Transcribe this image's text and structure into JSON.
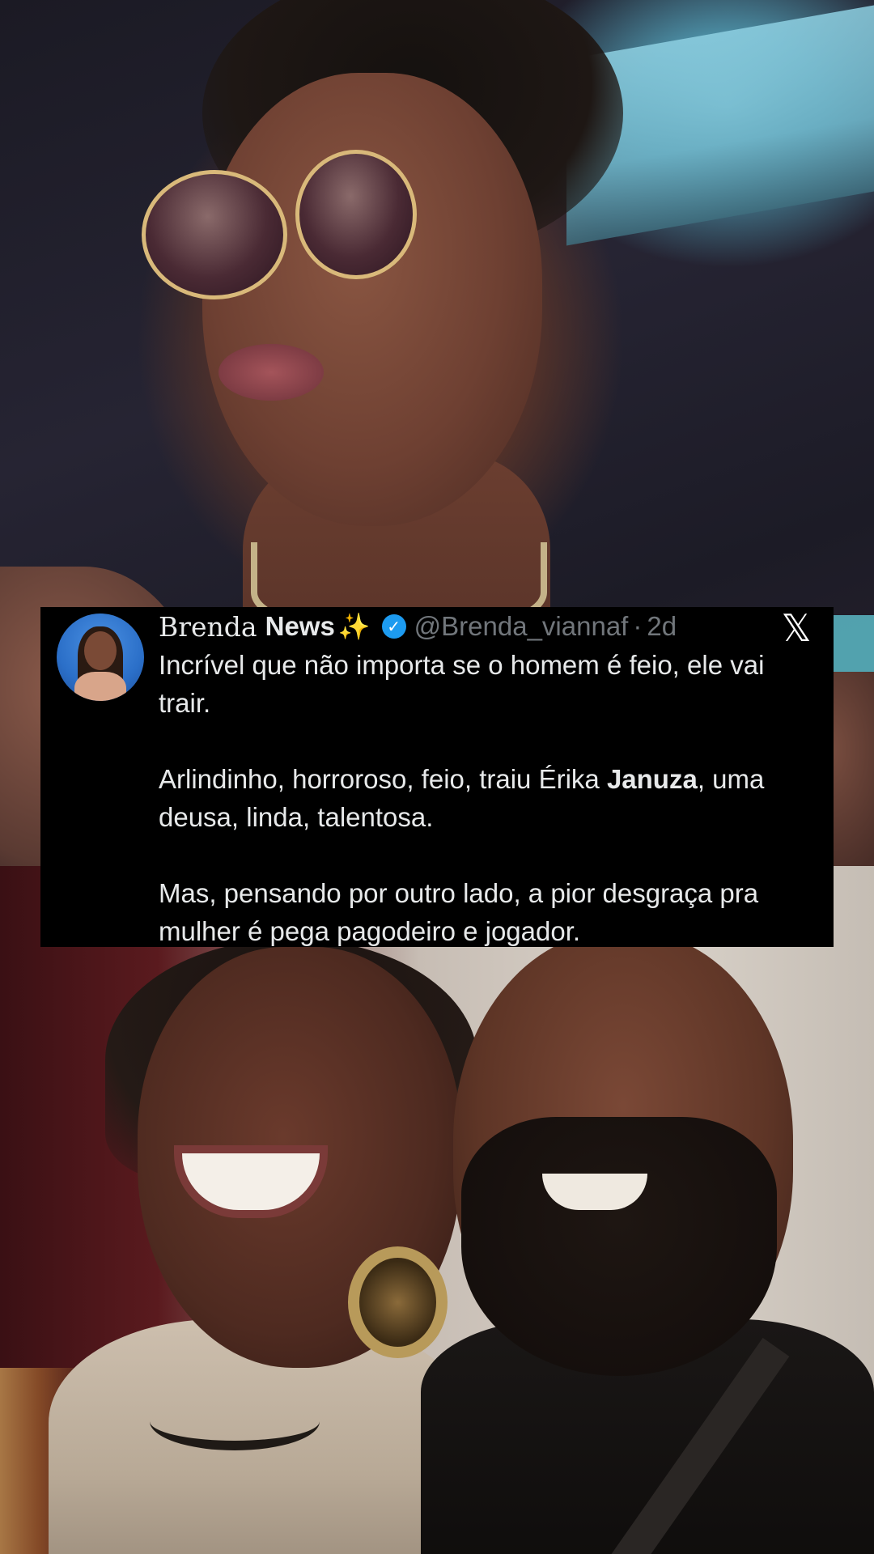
{
  "tweet": {
    "display_name_part1": "Brenda",
    "display_name_part2": "News",
    "display_name_emoji": "✨",
    "handle": "@Brenda_viannaf",
    "separator": "·",
    "time": "2d",
    "platform_logo": "𝕏",
    "paragraph1": "Incrível que não importa se o homem é feio, ele vai trair.",
    "paragraph2_before_bold": "Arlindinho, horroroso, feio, traiu Érika ",
    "paragraph2_bold": "Januza",
    "paragraph2_after_bold": ", uma deusa, linda, talentosa.",
    "paragraph3": "Mas, pensando por outro lado, a pior desgraça pra mulher é pega pagodeiro e jogador.",
    "verified_icon": "verified-badge-icon",
    "accent_color": "#1d9bf0"
  }
}
